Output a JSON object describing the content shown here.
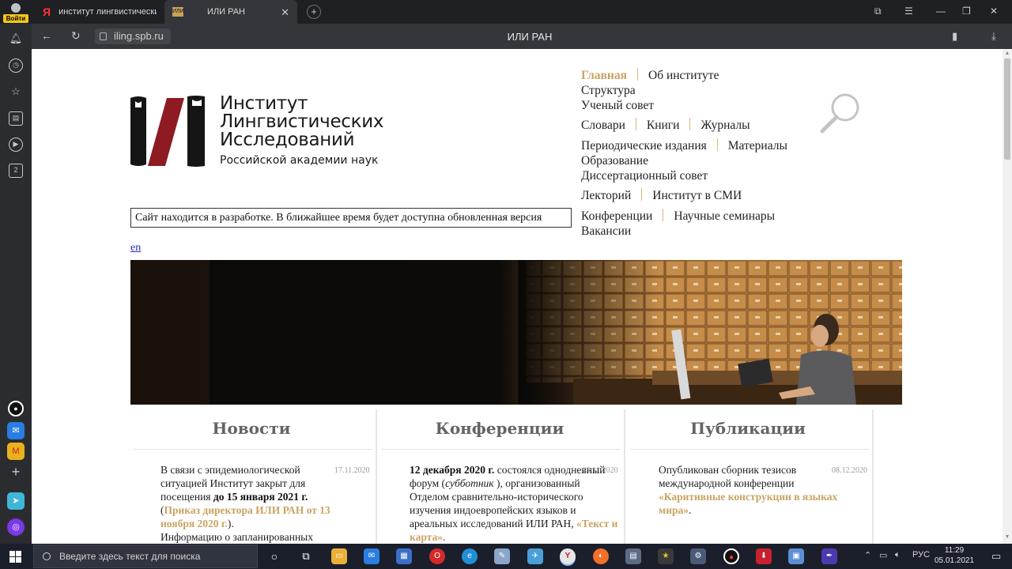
{
  "browser": {
    "profile_label": "Войти",
    "tabs": [
      {
        "label": "институт лингвистических",
        "favicon": "Я"
      },
      {
        "label": "ИЛИ РАН",
        "favicon": "ИЛИ"
      }
    ],
    "url": "iling.spb.ru",
    "page_title": "ИЛИ РАН"
  },
  "sidebar": {
    "counter_badge": "2"
  },
  "site": {
    "logo": {
      "line1": "Институт",
      "line2": "Лингвистических",
      "line3": "Исследований",
      "subtitle": "Российской академии наук"
    },
    "dev_notice": "Сайт находится в разработке. В ближайшее время будет доступна обновленная версия",
    "lang_link": "en",
    "menu_rows": [
      [
        "Главная",
        "Об институте"
      ],
      [
        "Структура"
      ],
      [
        "Ученый совет"
      ],
      [
        "Словари",
        "Книги",
        "Журналы"
      ],
      [
        "Периодические издания",
        "Материалы"
      ],
      [
        "Образование"
      ],
      [
        "Диссертационный совет"
      ],
      [
        "Лекторий",
        "Институт в СМИ"
      ],
      [
        "Конференции",
        "Научные семинары"
      ],
      [
        "Вакансии"
      ]
    ],
    "columns": {
      "news": {
        "title": "Новости",
        "date": "17.11.2020",
        "t1": "В связи с эпидемиологической ситуацией Институт закрыт для посещения ",
        "b1": "до 15 января 2021 г.",
        "t2": " (",
        "link": "Приказ директора ИЛИ РАН от 13 ноября 2020 г.",
        "t3": ").",
        "t4": "Информацию о запланированных"
      },
      "conferences": {
        "title": "Конференции",
        "date": "23.11.2020",
        "b1": "12 декабря 2020 г.",
        "t1": " состоялся однодневный форум (",
        "i1": "субботник",
        "t2": " ), организованный Отделом сравнительно-исторического изучения индоевропейских языков и ареальных исследований ИЛИ РАН, ",
        "link": "«Текст и карта»",
        "t3": "."
      },
      "publications": {
        "title": "Публикации",
        "date": "08.12.2020",
        "t1": "Опубликован сборник тезисов международной конференции ",
        "link": "«Каритивные конструкции в языках мира»",
        "t2": "."
      }
    }
  },
  "taskbar": {
    "search_placeholder": "Введите здесь текст для поиска",
    "lang": "РУС",
    "time": "11:29",
    "date": "05.01.2021"
  },
  "colors": {
    "accent_gold": "#c9a463",
    "logo_red": "#8e1a22",
    "logo_black": "#151515"
  }
}
